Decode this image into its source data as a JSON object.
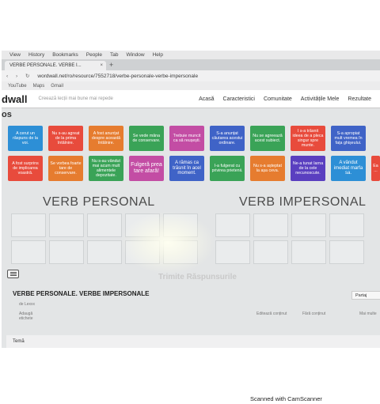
{
  "browser": {
    "menu": [
      "View",
      "History",
      "Bookmarks",
      "People",
      "Tab",
      "Window",
      "Help"
    ],
    "tab_title": "VERBE PERSONALE. VERBE I...",
    "tab_close": "×",
    "new_tab": "+",
    "url": "wordwall.net/ro/resource/7552718/verbe-personale-verbe-impersonale",
    "bookmarks": [
      "YouTube",
      "Maps",
      "Gmail"
    ]
  },
  "app": {
    "logo": "dwall",
    "search_placeholder": "Creează lecții mai bune mai repede",
    "nav": [
      "Acasă",
      "Caracteristici",
      "Comunitate",
      "Activitățile Mele",
      "Rezultate"
    ]
  },
  "game": {
    "section_label": "os",
    "cards_row1": [
      {
        "text": "A cerut un răspuns de la voi.",
        "color": "#2d8fd6"
      },
      {
        "text": "Nu s-au agreat de la prima întâlnire.",
        "color": "#e84b3c"
      },
      {
        "text": "A fost anunțat despre această întâlnire.",
        "color": "#e67c2f"
      },
      {
        "text": "Se vede mâna de conservare.",
        "color": "#3aa357"
      },
      {
        "text": "Trebuie muncit ca să reușești.",
        "color": "#c34da4"
      },
      {
        "text": "S-a anunțat căutarea acestui ordinare.",
        "color": "#3f63c7"
      },
      {
        "text": "Nu se agreează acest subiect.",
        "color": "#3aa357"
      },
      {
        "text": "I s-a trăsnit ideea de a pleca singur spre munte.",
        "color": "#e84b3c"
      },
      {
        "text": "S-a apropiat mult vremea în fața ghișeului.",
        "color": "#3f63c7"
      }
    ],
    "cards_row2": [
      {
        "text": "A fost surprins de implicarea voastră.",
        "color": "#e84b3c"
      },
      {
        "text": "Se vorbea foarte tare de conservare.",
        "color": "#e67c2f"
      },
      {
        "text": "Nu s-au vândut mai acum mult alimentele depozitate.",
        "color": "#3aa357"
      },
      {
        "text": "Fulgeră prea tare afară!",
        "color": "#c34da4"
      },
      {
        "text": "A rămas ca trăsnit în acel moment.",
        "color": "#3f63c7"
      },
      {
        "text": "I-a fulgerat cu privirea prietenii.",
        "color": "#3aa357"
      },
      {
        "text": "Nu s-a așteptat la așa ceva.",
        "color": "#e67c2f"
      },
      {
        "text": "Ne-a tunat Iarna de la cele necunoscute.",
        "color": "#5a3fc0"
      },
      {
        "text": "A vândut imediat marfa sa.",
        "color": "#2d8fd6"
      },
      {
        "text": "Ea ...",
        "color": "#e84b3c"
      }
    ],
    "heading_left": "VERB PERSONAL",
    "heading_right": "VERB IMPERSONAL",
    "submit_label": "Trimite Răspunsurile",
    "activity_title": "VERBE PERSONALE. VERBE IMPERSONALE",
    "meta": [
      "de Lexxx",
      "Adaugă etichete",
      "Editează conținut",
      "Fără conținut",
      "Mai multe"
    ],
    "share_label": "Partaj",
    "tema_label": "Temă"
  },
  "scan": {
    "watermark": "Scanned with CamScanner"
  }
}
